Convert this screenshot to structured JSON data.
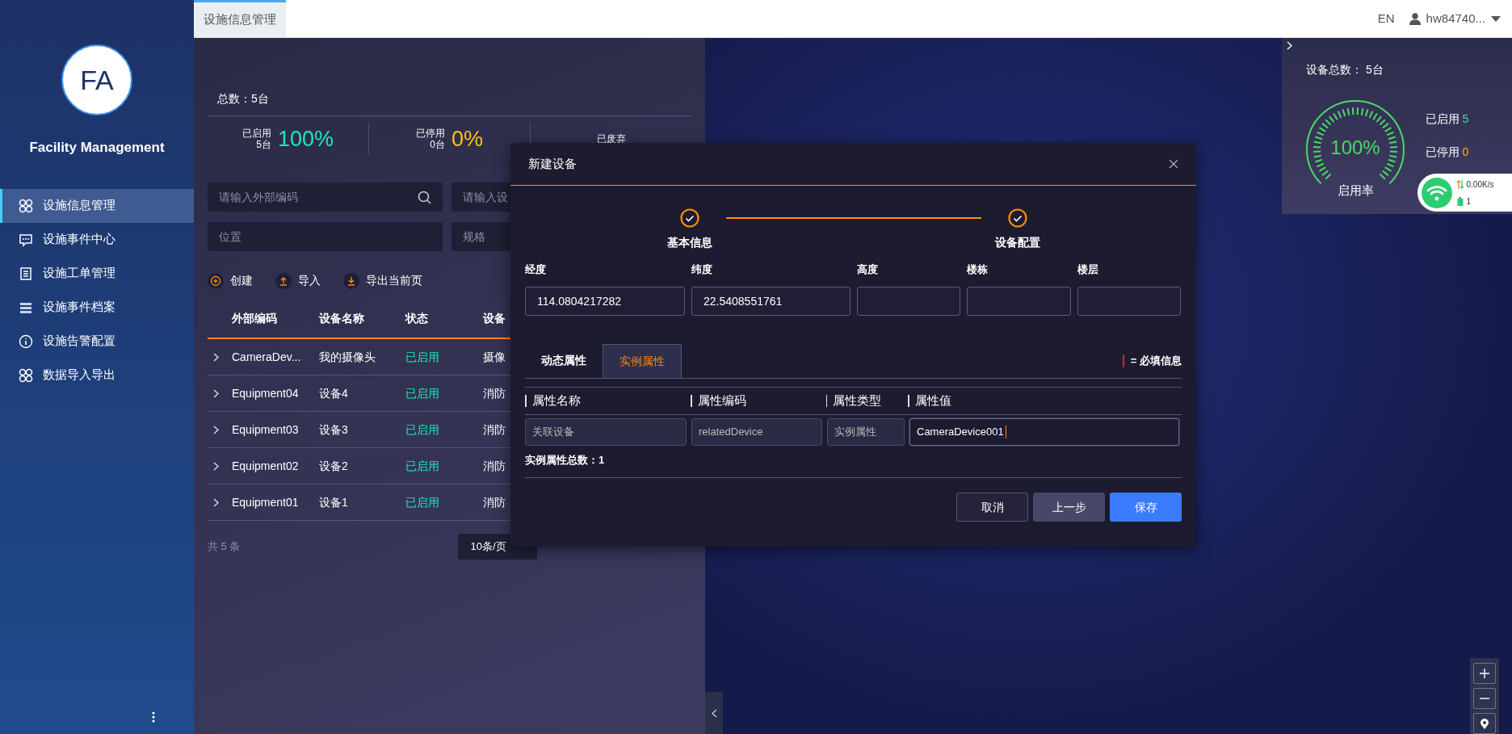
{
  "header": {
    "tab": {
      "label": "设施信息管理",
      "selected": true
    },
    "language": "EN",
    "user": "hw84740..."
  },
  "sidebar": {
    "logo": "FA",
    "app_name": "Facility Management",
    "items": [
      {
        "label": "设施信息管理",
        "selected": true
      },
      {
        "label": "设施事件中心",
        "selected": false
      },
      {
        "label": "设施工单管理",
        "selected": false
      },
      {
        "label": "设施事件档案",
        "selected": false
      },
      {
        "label": "设施告警配置",
        "selected": false
      },
      {
        "label": "数据导入导出",
        "selected": false
      }
    ]
  },
  "summary": {
    "total": "总数：5台",
    "stats": [
      {
        "label": "已启用",
        "count": "5台",
        "percent": "100%",
        "color": "#1de9b6"
      },
      {
        "label": "已停用",
        "count": "0台",
        "percent": "0%",
        "color": "#ffc107"
      },
      {
        "label": "已废弃"
      }
    ]
  },
  "filters": [
    {
      "placeholder": "请输入外部编码",
      "search": true
    },
    {
      "placeholder": "请输入设"
    },
    {
      "placeholder": "位置"
    },
    {
      "placeholder": "规格"
    }
  ],
  "actions": [
    "创建",
    "导入",
    "导出当前页"
  ],
  "table": {
    "columns": [
      "外部编码",
      "设备名称",
      "状态",
      "设备"
    ],
    "rows": [
      {
        "cells": [
          "CameraDev...",
          "我的摄像头",
          "已启用",
          "摄像"
        ]
      },
      {
        "cells": [
          "Equipment04",
          "设备4",
          "已启用",
          "消防"
        ]
      },
      {
        "cells": [
          "Equipment03",
          "设备3",
          "已启用",
          "消防"
        ]
      },
      {
        "cells": [
          "Equipment02",
          "设备2",
          "已启用",
          "消防"
        ]
      },
      {
        "cells": [
          "Equipment01",
          "设备1",
          "已启用",
          "消防"
        ]
      }
    ]
  },
  "pagination": {
    "total": "共 5 条",
    "page_size": "10条/页"
  },
  "modal": {
    "title": "新建设备",
    "steps": [
      {
        "label": "基本信息",
        "done": true
      },
      {
        "label": "设备配置",
        "done": true
      }
    ],
    "fields": [
      {
        "label": "经度",
        "value": "114.0804217282"
      },
      {
        "label": "纬度",
        "value": "22.5408551761"
      },
      {
        "label": "高度"
      },
      {
        "label": "楼栋"
      },
      {
        "label": "楼层"
      }
    ],
    "tabs": [
      {
        "label": "动态属性",
        "selected": false
      },
      {
        "label": "实例属性",
        "selected": true
      }
    ],
    "required_note": "= 必填信息",
    "prop_columns": [
      "属性名称",
      "属性编码",
      "属性类型",
      "属性值"
    ],
    "prop_row": [
      {
        "value": "关联设备",
        "readonly": true
      },
      {
        "value": "relatedDevice",
        "readonly": true
      },
      {
        "value": "实例属性",
        "readonly": true
      },
      {
        "value": "CameraDevice001",
        "readonly": false
      }
    ],
    "count": "实例属性总数：1",
    "buttons": [
      {
        "label": "取消",
        "kind": "cancel"
      },
      {
        "label": "上一步",
        "kind": "back"
      },
      {
        "label": "保存",
        "kind": "primary"
      }
    ]
  },
  "map_panel": {
    "total": "设备总数： 5台",
    "gauge": {
      "percent": "100%",
      "label": "启用率"
    },
    "stats": [
      {
        "label": "已启用",
        "value": "5",
        "color": "#1de9b6"
      },
      {
        "label": "已停用",
        "value": "0",
        "color": "#ffb300"
      }
    ]
  },
  "network": {
    "speed": "0.00K/s",
    "count": "1"
  }
}
